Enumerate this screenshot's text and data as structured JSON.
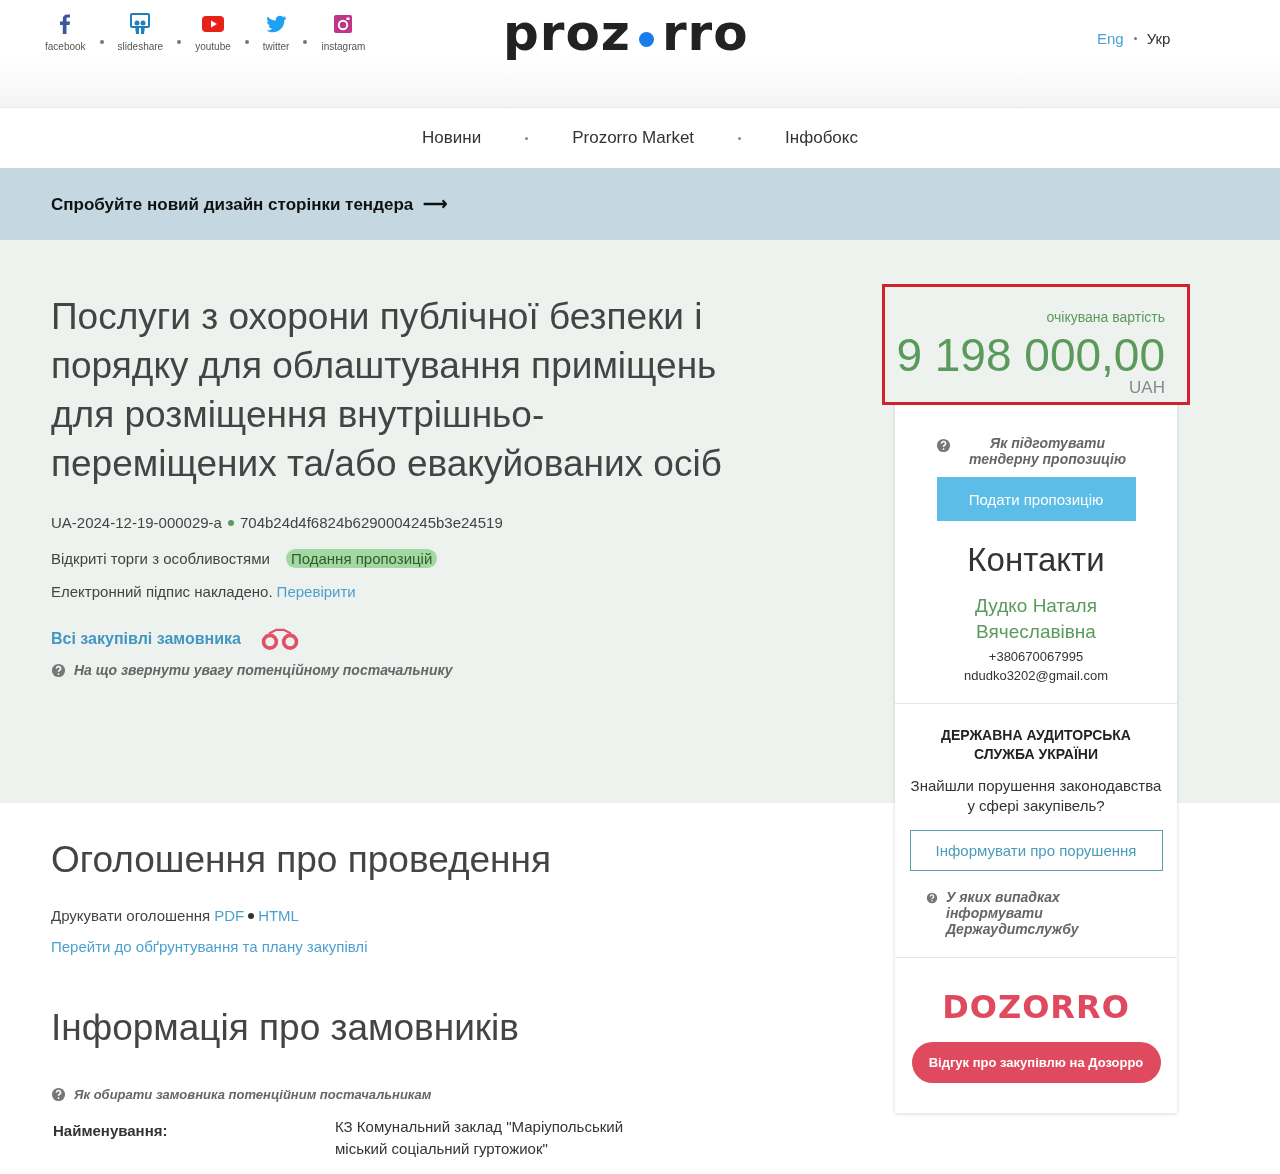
{
  "social_links": [
    {
      "kind": "facebook",
      "label": "facebook"
    },
    {
      "kind": "slideshare",
      "label": "slideshare"
    },
    {
      "kind": "youtube",
      "label": "youtube"
    },
    {
      "kind": "twitter",
      "label": "twitter"
    },
    {
      "kind": "instagram",
      "label": "instagram"
    }
  ],
  "logo": {
    "left": "proz",
    "right": "rro"
  },
  "languages": [
    {
      "label": "Eng",
      "selected": false
    },
    {
      "label": "Укр",
      "selected": true
    }
  ],
  "nav": [
    "Новини",
    "Prozorro Market",
    "Інфобокс"
  ],
  "banner": {
    "text": "Спробуйте новий дизайн сторінки тендера",
    "arrow": "⟶"
  },
  "tender": {
    "title": "Послуги з охорони публічної безпеки і порядку для облаштування приміщень для розміщення внутрішньо-переміщених та/або евакуйованих осіб",
    "id": "UA-2024-12-19-000029-a",
    "hash": "704b24d4f6824b6290004245b3e24519",
    "procedure": "Відкриті торги з особливостями",
    "status": "Подання пропозицій",
    "signature": "Електронний підпис накладено.",
    "signature_link": "Перевірити",
    "buyer_link": "Всі закупівлі замовника",
    "hint": "На що звернути увагу потенційному постачальнику"
  },
  "announcement": {
    "heading": "Оголошення про проведення",
    "print_label": "Друкувати оголошення",
    "print_links": [
      "PDF",
      "HTML"
    ],
    "plan_link": "Перейти до обґрунтування та плану закупівлі"
  },
  "buyers": {
    "heading": "Інформація про замовників",
    "hint": "Як обирати замовника потенційним постачальникам",
    "fields": [
      {
        "label": "Найменування:",
        "value": "КЗ Комунальний заклад \"Маріупольський міський соціальний гуртожиок\""
      }
    ]
  },
  "price": {
    "label": "очікувана вартість",
    "amount": "9 198 000,00",
    "currency": "UAH"
  },
  "sidebar": {
    "hint": "Як підготувати тендерну пропозицію",
    "submit": "Подати пропозицію",
    "contacts_heading": "Контакти",
    "contact_name": "Дудко Наталя Вячеславівна",
    "phone": "+380670067995",
    "email": "ndudko3202@gmail.com",
    "audit_heading": "ДЕРЖАВНА АУДИТОРСЬКА СЛУЖБА УКРАЇНИ",
    "audit_text": "Знайшли порушення законодавства у сфері закупівель?",
    "audit_button": "Інформувати про порушення",
    "audit_hint": "У яких випадках інформувати Держаудитслужбу",
    "dozorro_logo": "DOZORRO",
    "dozorro_button": "Відгук про закупівлю на Дозорро"
  }
}
